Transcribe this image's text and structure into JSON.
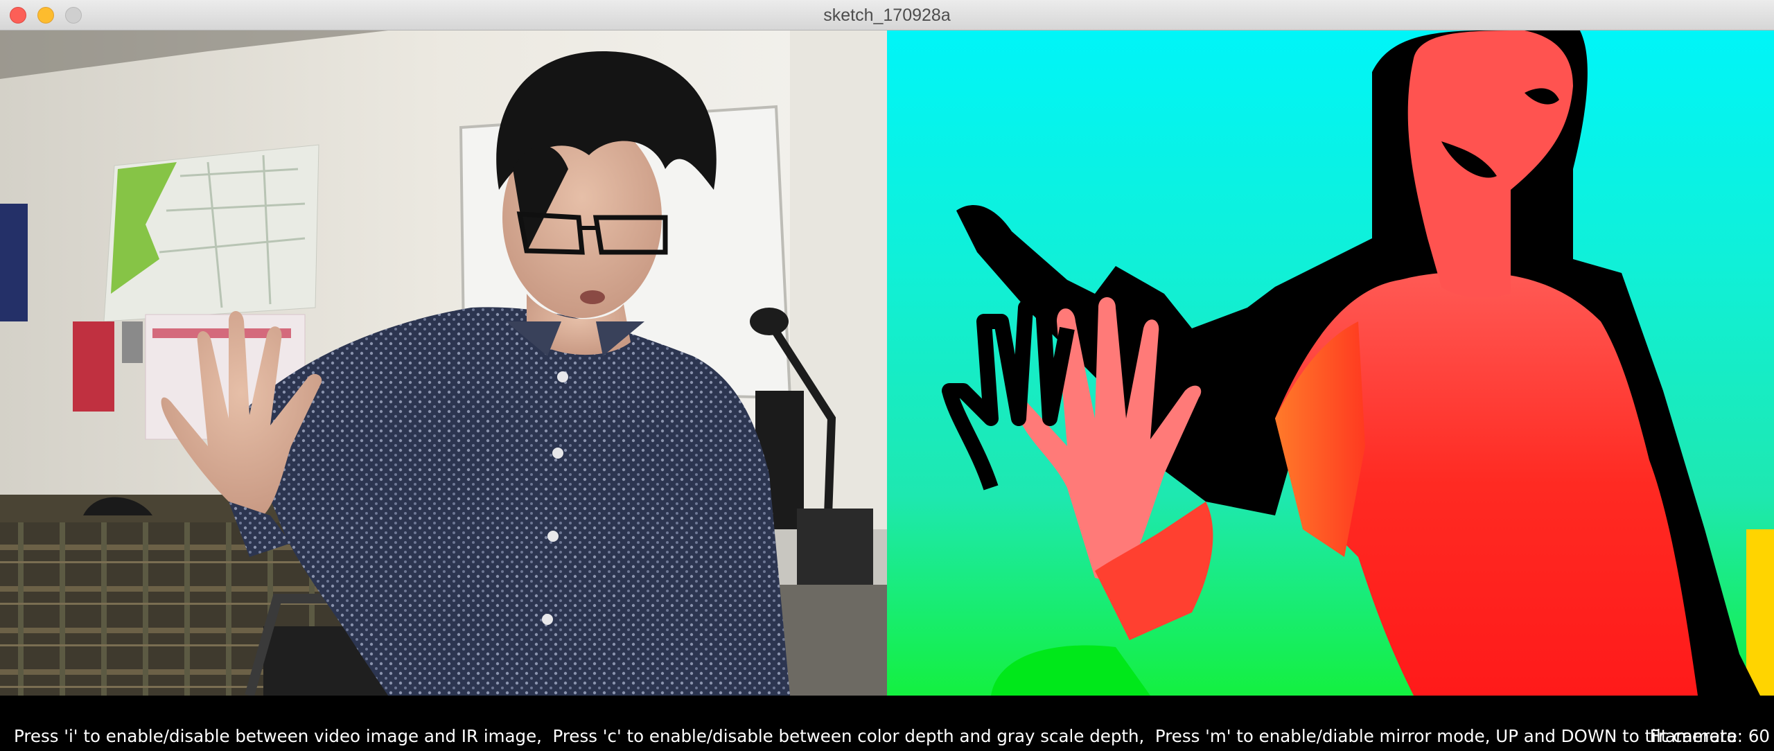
{
  "window": {
    "title": "sketch_170928a",
    "controls": {
      "close_icon": "close-icon",
      "minimize_icon": "minimize-icon",
      "zoom_icon": "zoom-icon"
    }
  },
  "panes": {
    "video": {
      "content": "RGB webcam image"
    },
    "depth": {
      "content": "Color depth map"
    }
  },
  "status": {
    "instructions": "Press 'i' to enable/disable between video image and IR image,  Press 'c' to enable/disable between color depth and gray scale depth,  Press 'm' to enable/diable mirror mode, UP and DOWN to tilt camera",
    "framerate": "Framerate: 60"
  },
  "colors": {
    "close": "#fc5f57",
    "minimize": "#fdbc2e",
    "zoom": "#cfcfcf",
    "depth_background": "#1be8c8",
    "depth_person": "#ff2a2a"
  }
}
